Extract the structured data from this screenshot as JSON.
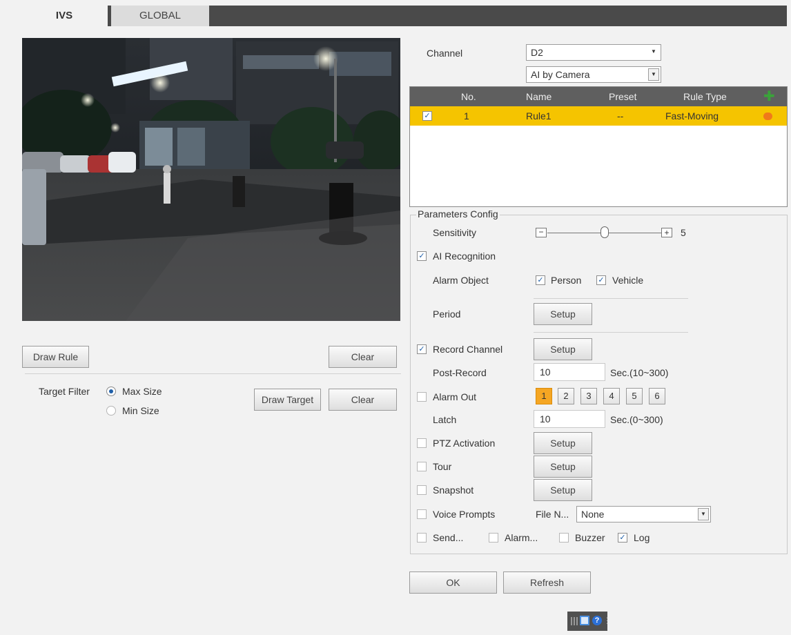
{
  "tabs": [
    {
      "label": "IVS",
      "active": true
    },
    {
      "label": "GLOBAL",
      "active": false
    }
  ],
  "left": {
    "draw_rule": "Draw Rule",
    "clear": "Clear",
    "target_filter_label": "Target Filter",
    "max_size": "Max Size",
    "min_size": "Min Size",
    "draw_target": "Draw Target",
    "clear2": "Clear"
  },
  "channel": {
    "label": "Channel",
    "value": "D2",
    "mode": "AI by Camera"
  },
  "rule_table": {
    "headers": [
      "No.",
      "Name",
      "Preset",
      "Rule Type"
    ],
    "rows": [
      {
        "checked": true,
        "no": "1",
        "name": "Rule1",
        "preset": "--",
        "type": "Fast-Moving"
      }
    ]
  },
  "params": {
    "legend": "Parameters Config",
    "sensitivity_label": "Sensitivity",
    "sensitivity_value": "5",
    "sensitivity_level": 0.5,
    "ai_recognition": "AI Recognition",
    "alarm_object": "Alarm Object",
    "person": "Person",
    "vehicle": "Vehicle",
    "period": "Period",
    "setup": "Setup",
    "record_channel": "Record Channel",
    "post_record": "Post-Record",
    "post_record_value": "10",
    "post_record_range": "Sec.(10~300)",
    "alarm_out": "Alarm Out",
    "alarm_out_channels": [
      "1",
      "2",
      "3",
      "4",
      "5",
      "6"
    ],
    "latch": "Latch",
    "latch_value": "10",
    "latch_range": "Sec.(0~300)",
    "ptz_activation": "PTZ Activation",
    "tour": "Tour",
    "snapshot": "Snapshot",
    "voice_prompts": "Voice Prompts",
    "file_name_label": "File N...",
    "file_name_value": "None",
    "send": "Send...",
    "alarm": "Alarm...",
    "buzzer": "Buzzer",
    "log": "Log"
  },
  "footer": {
    "ok": "OK",
    "refresh": "Refresh"
  },
  "colors": {
    "tab_bar": "#4a4a4a",
    "table_header": "#5f5f5f",
    "selected_row": "#f5c400",
    "add_icon": "#3aa33a",
    "remove_icon": "#f07a1a",
    "alarm_out_active": "#f5a623"
  }
}
